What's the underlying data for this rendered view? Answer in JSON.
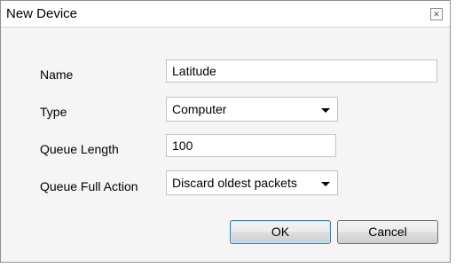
{
  "window": {
    "title": "New Device",
    "close_glyph": "✕"
  },
  "form": {
    "name_label": "Name",
    "name_value": "Latitude",
    "type_label": "Type",
    "type_value": "Computer",
    "queue_length_label": "Queue Length",
    "queue_length_value": "100",
    "queue_full_action_label": "Queue Full Action",
    "queue_full_action_value": "Discard oldest packets"
  },
  "buttons": {
    "ok_label": "OK",
    "cancel_label": "Cancel"
  },
  "icons": {
    "close": "close-icon",
    "dropdown": "chevron-down-icon"
  }
}
